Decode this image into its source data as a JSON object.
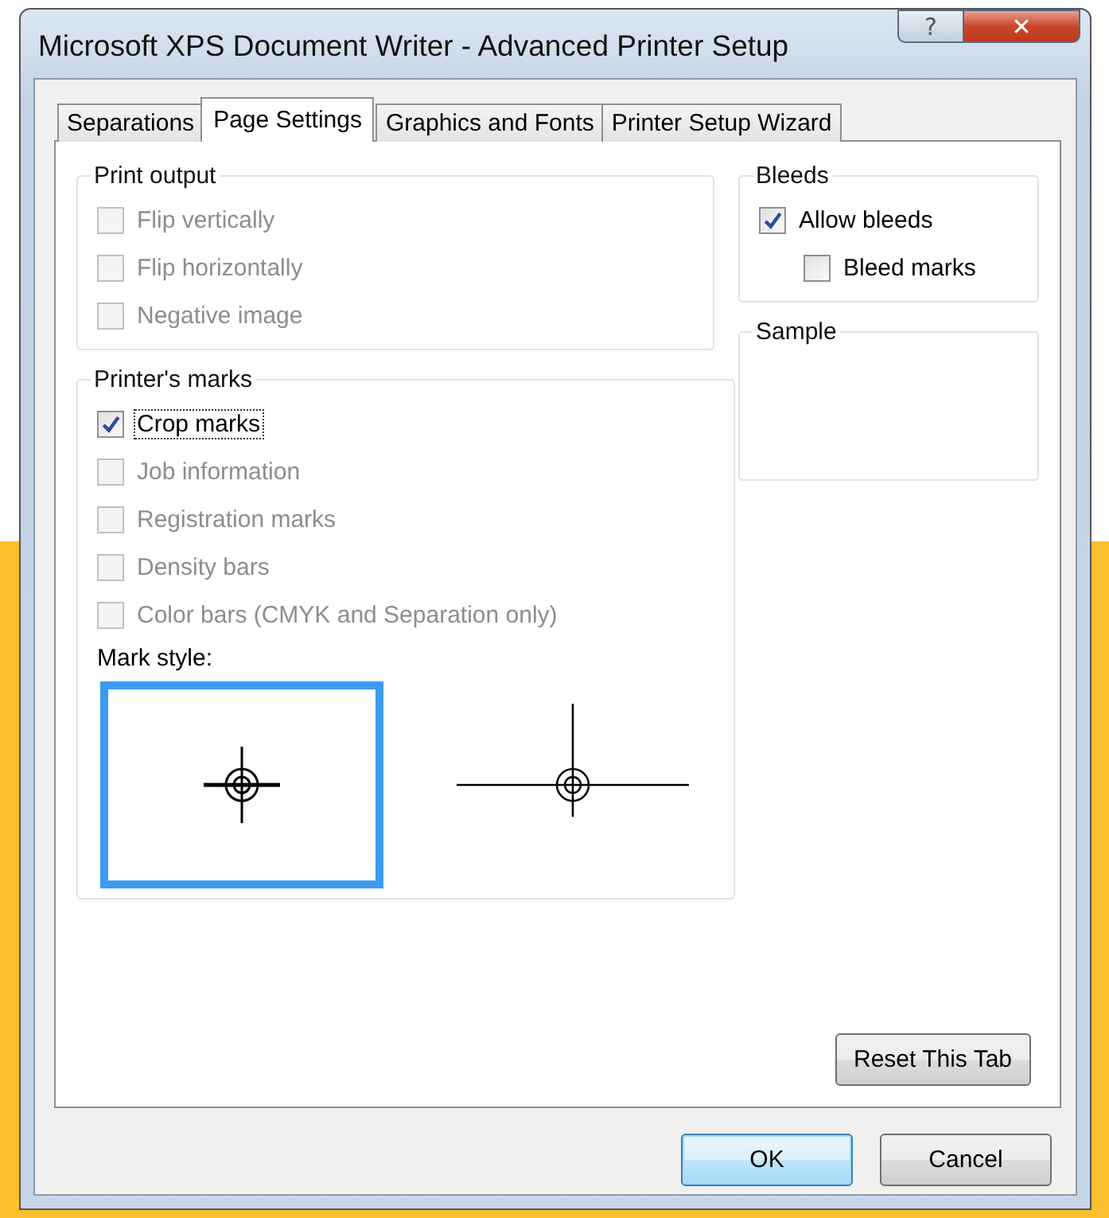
{
  "window": {
    "title": "Microsoft XPS Document Writer - Advanced Printer Setup",
    "buttons": [
      {
        "kind": "help",
        "label": "?"
      },
      {
        "kind": "close",
        "label": "✕"
      }
    ]
  },
  "tabs": [
    {
      "label": "Separations",
      "selected": false
    },
    {
      "label": "Page Settings",
      "selected": true
    },
    {
      "label": "Graphics and Fonts",
      "selected": false
    },
    {
      "label": "Printer Setup Wizard",
      "selected": false
    }
  ],
  "print_output": {
    "title": "Print output",
    "options": [
      {
        "label": "Flip vertically",
        "checked": false,
        "disabled": true,
        "focused": false
      },
      {
        "label": "Flip horizontally",
        "checked": false,
        "disabled": true,
        "focused": false
      },
      {
        "label": "Negative image",
        "checked": false,
        "disabled": true,
        "focused": false
      }
    ]
  },
  "printers_marks": {
    "title": "Printer's marks",
    "options": [
      {
        "label": "Crop marks",
        "checked": true,
        "disabled": false,
        "focused": true
      },
      {
        "label": "Job information",
        "checked": false,
        "disabled": true,
        "focused": false
      },
      {
        "label": "Registration marks",
        "checked": false,
        "disabled": true,
        "focused": false
      },
      {
        "label": "Density bars",
        "checked": false,
        "disabled": true,
        "focused": false
      },
      {
        "label": "Color bars (CMYK and Separation only)",
        "checked": false,
        "disabled": true,
        "focused": false
      }
    ],
    "mark_style": {
      "label": "Mark style:",
      "options": [
        {
          "kind": "short",
          "selected": true
        },
        {
          "kind": "long",
          "selected": false
        }
      ]
    }
  },
  "bleeds": {
    "title": "Bleeds",
    "options": [
      {
        "label": "Allow bleeds",
        "checked": true,
        "disabled": false,
        "focused": false,
        "children": [
          {
            "label": "Bleed marks",
            "checked": false,
            "disabled": false,
            "focused": false
          }
        ]
      }
    ]
  },
  "sample": {
    "title": "Sample"
  },
  "reset_button": "Reset This Tab",
  "buttons": [
    {
      "label": "OK",
      "default": true
    },
    {
      "label": "Cancel",
      "default": false
    }
  ]
}
